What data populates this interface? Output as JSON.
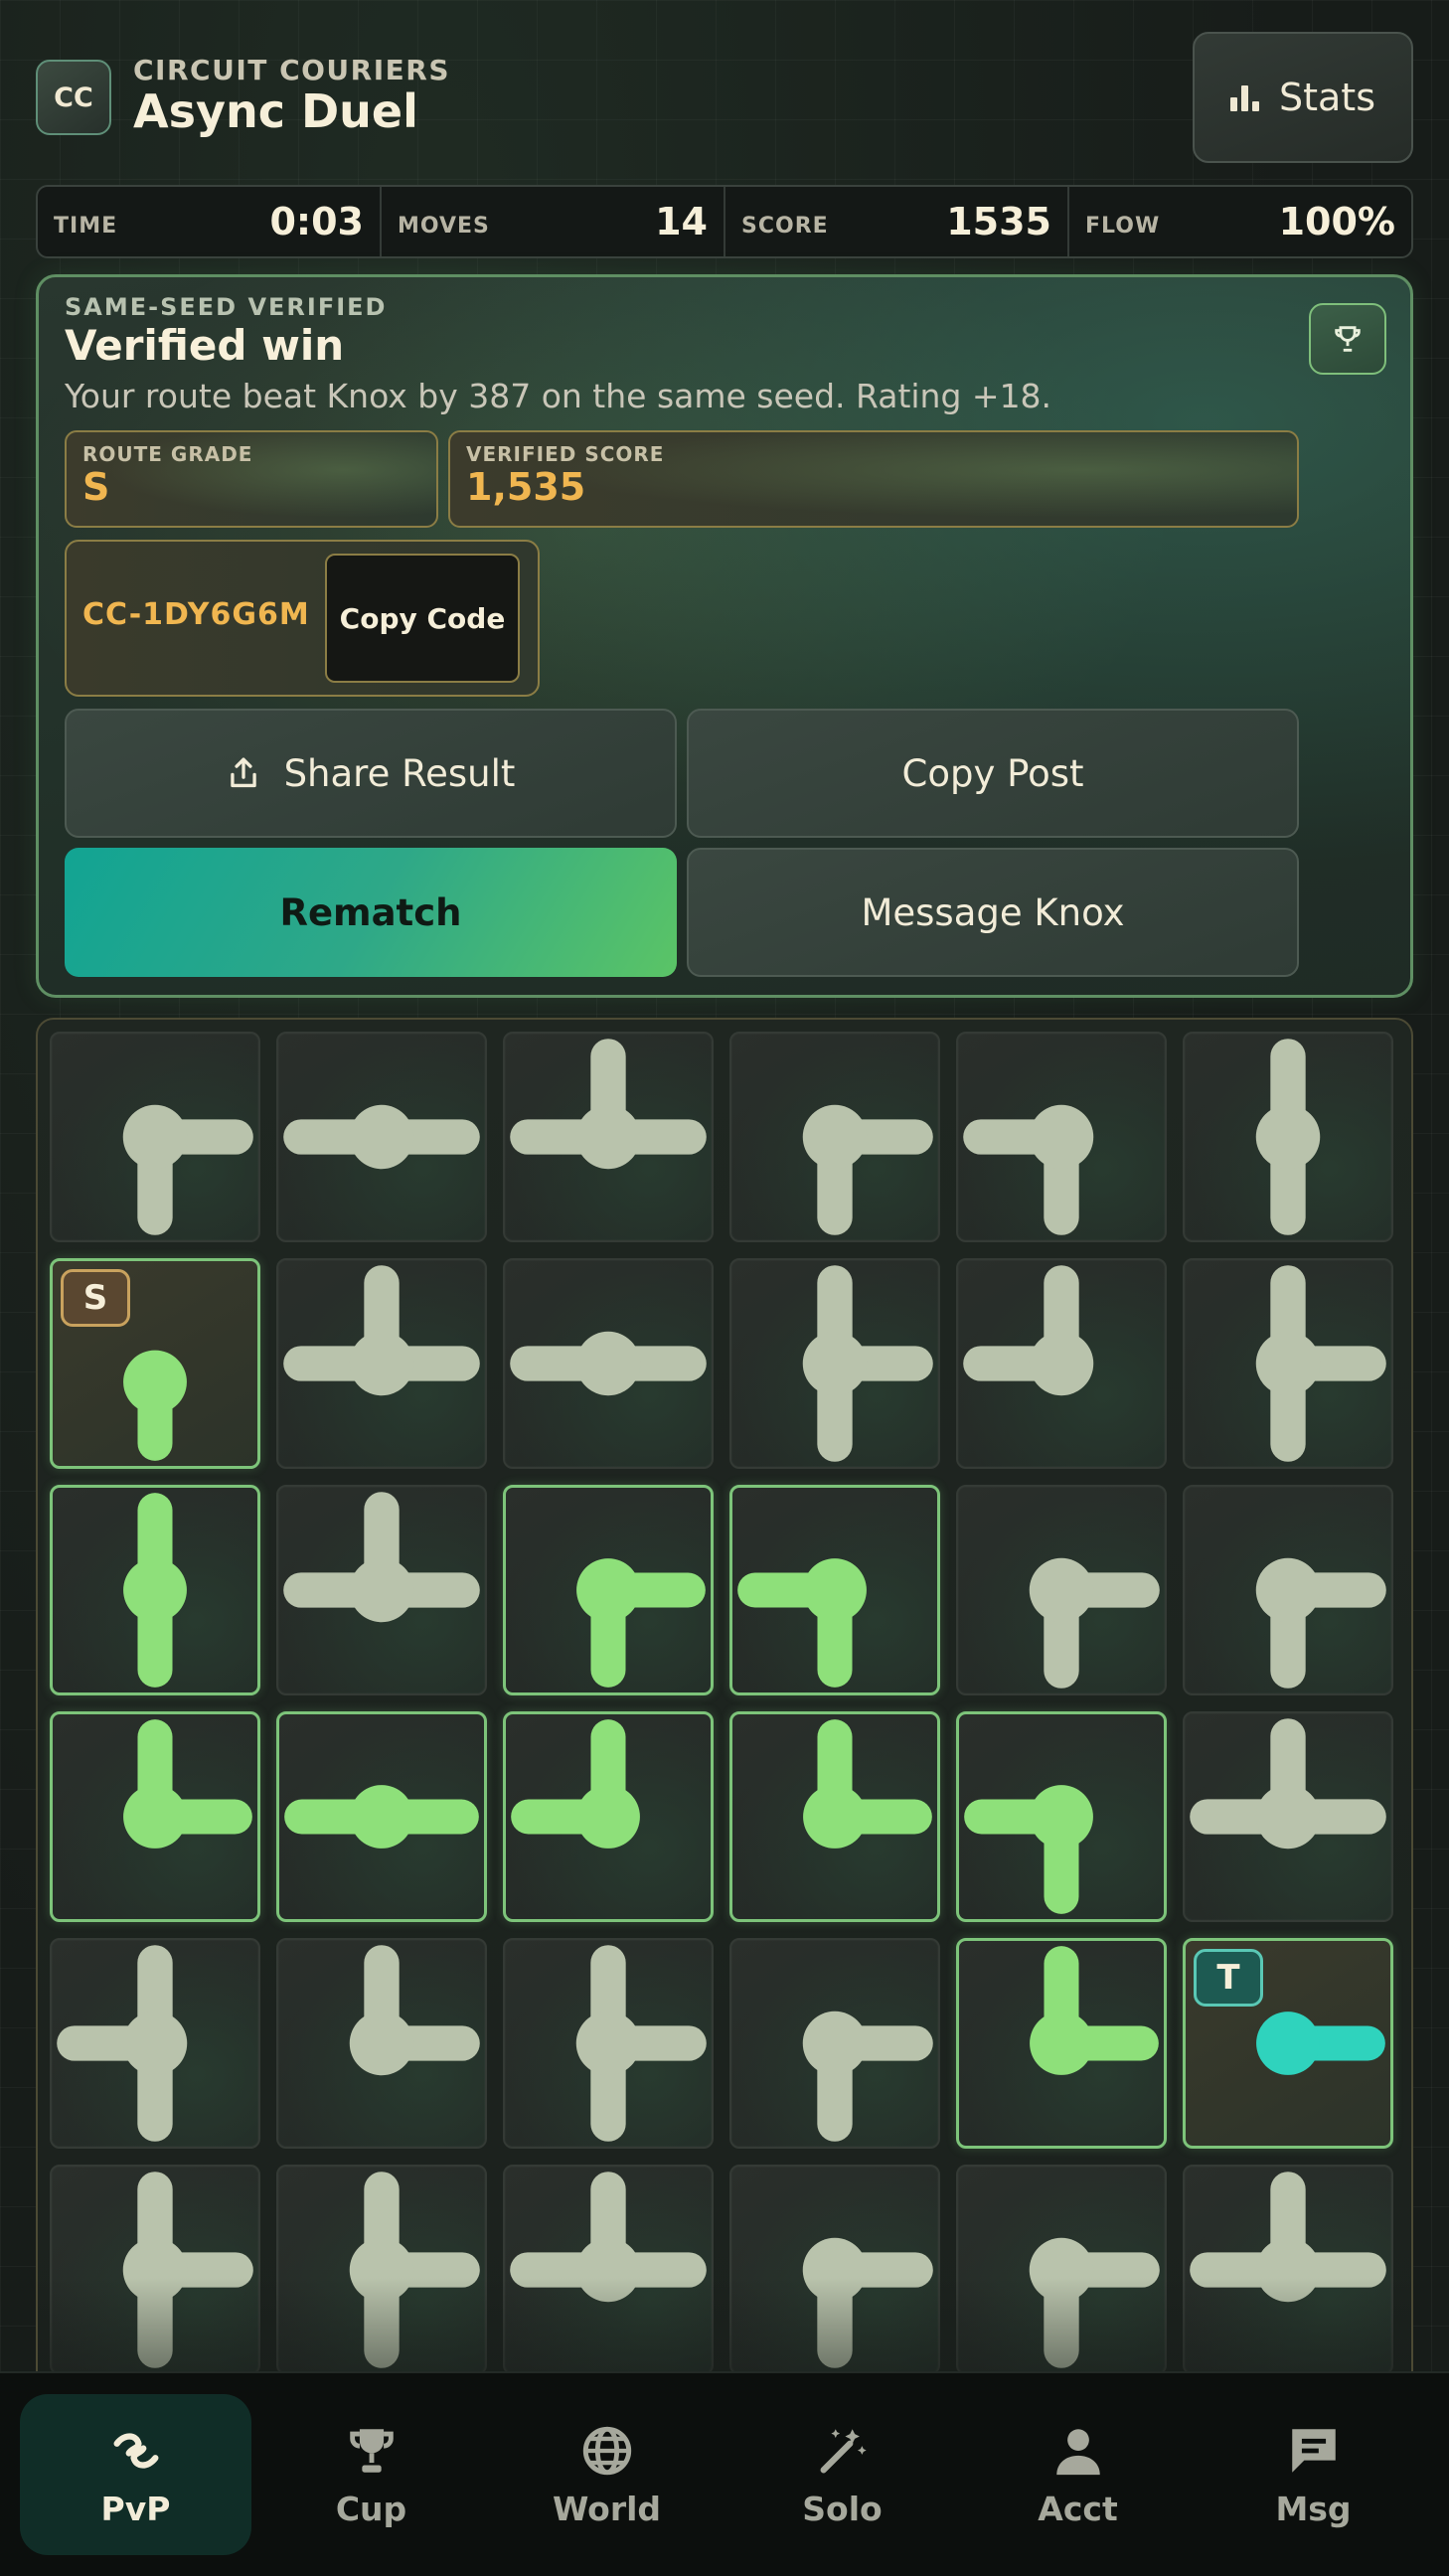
{
  "header": {
    "logo": "CC",
    "brand_sub": "CIRCUIT COURIERS",
    "title": "Async Duel",
    "stats_label": "Stats",
    "stats_icon": "bar-chart-icon"
  },
  "hud": [
    {
      "label": "TIME",
      "value": "0:03"
    },
    {
      "label": "MOVES",
      "value": "14"
    },
    {
      "label": "SCORE",
      "value": "1535"
    },
    {
      "label": "FLOW",
      "value": "100%"
    }
  ],
  "result": {
    "eyebrow": "SAME-SEED VERIFIED",
    "title": "Verified win",
    "description": "Your route beat Knox by 387 on the same seed. Rating +18.",
    "trophy_icon": "trophy-icon",
    "route_grade_label": "ROUTE GRADE",
    "route_grade": "S",
    "verified_score_label": "VERIFIED SCORE",
    "verified_score": "1,535",
    "code": "CC-1DY6G6M",
    "copy_code_label": "Copy Code",
    "share_label": "Share Result",
    "share_icon": "share-icon",
    "copy_post_label": "Copy Post",
    "rematch_label": "Rematch",
    "message_label": "Message Knox"
  },
  "board": {
    "columns": 6,
    "rows": 6,
    "start_label": "S",
    "target_label": "T",
    "colors": {
      "pipe": "#b9c3ac",
      "lit": "#8ee07a",
      "target": "#2fd3bd"
    },
    "tiles": [
      [
        {
          "c": "ELS",
          "s": "off"
        },
        {
          "c": "EW",
          "s": "off"
        },
        {
          "c": "NEW",
          "s": "off"
        },
        {
          "c": "ELS",
          "s": "off"
        },
        {
          "c": "WS",
          "s": "off"
        },
        {
          "c": "NS",
          "s": "off"
        }
      ],
      [
        {
          "c": "S",
          "s": "lit",
          "m": "start"
        },
        {
          "c": "NEW",
          "s": "off"
        },
        {
          "c": "EW",
          "s": "off"
        },
        {
          "c": "NES",
          "s": "off"
        },
        {
          "c": "NW",
          "s": "off"
        },
        {
          "c": "NES",
          "s": "off"
        }
      ],
      [
        {
          "c": "NS",
          "s": "lit"
        },
        {
          "c": "NEW",
          "s": "off"
        },
        {
          "c": "ES",
          "s": "lit"
        },
        {
          "c": "WS",
          "s": "lit"
        },
        {
          "c": "ELS",
          "s": "off"
        },
        {
          "c": "ES",
          "s": "off"
        }
      ],
      [
        {
          "c": "NE",
          "s": "lit"
        },
        {
          "c": "EW",
          "s": "lit"
        },
        {
          "c": "NW",
          "s": "lit"
        },
        {
          "c": "NE",
          "s": "lit"
        },
        {
          "c": "WS",
          "s": "lit"
        },
        {
          "c": "NEW",
          "s": "off"
        }
      ],
      [
        {
          "c": "NSW",
          "s": "off"
        },
        {
          "c": "NE",
          "s": "off"
        },
        {
          "c": "NES",
          "s": "off"
        },
        {
          "c": "ELS",
          "s": "off"
        },
        {
          "c": "NE",
          "s": "lit"
        },
        {
          "c": "E",
          "s": "target",
          "m": "target"
        }
      ],
      [
        {
          "c": "NES",
          "s": "off"
        },
        {
          "c": "NES",
          "s": "off"
        },
        {
          "c": "NEW",
          "s": "off"
        },
        {
          "c": "ES",
          "s": "off"
        },
        {
          "c": "ELS",
          "s": "off"
        },
        {
          "c": "NEW",
          "s": "off"
        }
      ]
    ]
  },
  "nav": [
    {
      "label": "PvP",
      "icon": "pvp-icon",
      "active": true
    },
    {
      "label": "Cup",
      "icon": "trophy-icon",
      "active": false
    },
    {
      "label": "World",
      "icon": "globe-icon",
      "active": false
    },
    {
      "label": "Solo",
      "icon": "wand-icon",
      "active": false
    },
    {
      "label": "Acct",
      "icon": "person-icon",
      "active": false
    },
    {
      "label": "Msg",
      "icon": "message-icon",
      "active": false
    }
  ]
}
